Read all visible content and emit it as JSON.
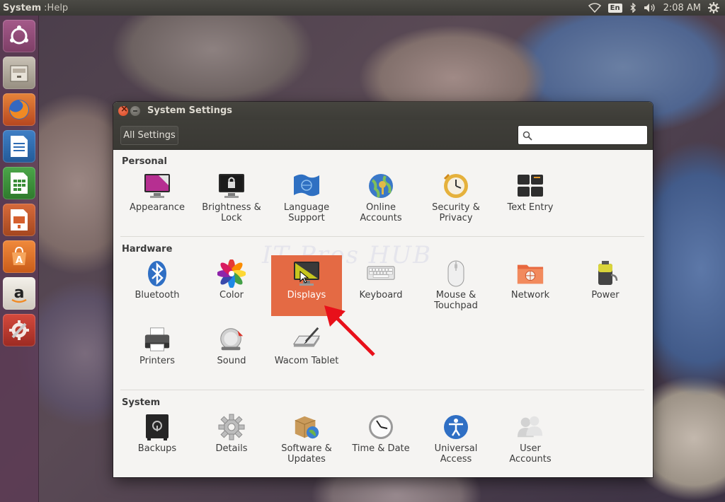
{
  "top_panel": {
    "app_name": "System",
    "menu_help": "Help",
    "keyboard_layout": "En",
    "clock": "2:08 AM"
  },
  "launcher": {
    "items": [
      "ubuntu-dash",
      "files",
      "firefox",
      "libreoffice-writer",
      "libreoffice-calc",
      "libreoffice-impress",
      "ubuntu-software-center",
      "amazon",
      "system-settings"
    ]
  },
  "window": {
    "title": "System Settings",
    "all_settings_label": "All Settings",
    "search_placeholder": "",
    "watermark": "IT Pros HUB"
  },
  "sections": {
    "personal": {
      "title": "Personal",
      "items": [
        "Appearance",
        "Brightness &\nLock",
        "Language\nSupport",
        "Online\nAccounts",
        "Security &\nPrivacy",
        "Text Entry"
      ]
    },
    "hardware": {
      "title": "Hardware",
      "items": [
        "Bluetooth",
        "Color",
        "Displays",
        "Keyboard",
        "Mouse &\nTouchpad",
        "Network",
        "Power",
        "Printers",
        "Sound",
        "Wacom Tablet"
      ],
      "selected": "Displays"
    },
    "system": {
      "title": "System",
      "items": [
        "Backups",
        "Details",
        "Software &\nUpdates",
        "Time & Date",
        "Universal\nAccess",
        "User\nAccounts"
      ]
    }
  },
  "colors": {
    "selected_bg": "#e46a44",
    "arrow": "#e8101a",
    "launcher_bg": "#5c3a54"
  }
}
